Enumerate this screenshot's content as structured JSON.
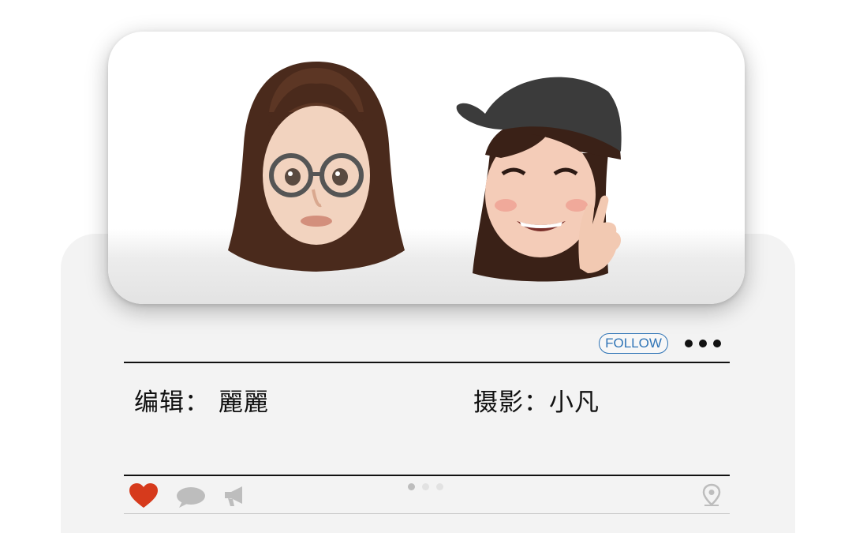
{
  "post": {
    "follow_label": "FOLLOW",
    "credits": {
      "editor": "编辑：  麗麗",
      "photographer": "摄影：小凡"
    },
    "pager": {
      "total": 3,
      "active": 0
    }
  },
  "icons": {
    "more": "more-dots-icon",
    "like": "heart-icon",
    "comment": "comment-bubble-icon",
    "share": "megaphone-icon",
    "location": "location-pin-icon"
  },
  "colors": {
    "follow": "#2f74b6",
    "like": "#d63a1c",
    "inactive_icon": "#bdbdbd"
  }
}
